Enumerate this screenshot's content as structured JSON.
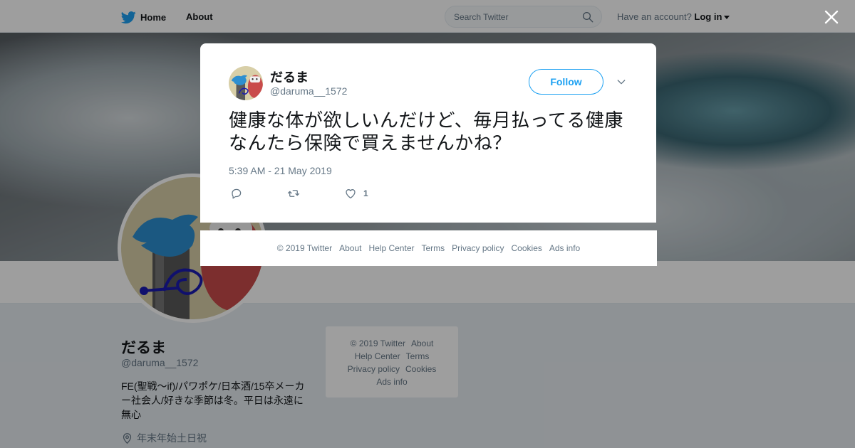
{
  "nav": {
    "home": "Home",
    "about": "About",
    "search_placeholder": "Search Twitter",
    "account_prompt": "Have an account?",
    "login": "Log in"
  },
  "profile": {
    "name": "だるま",
    "handle": "@daruma__1572",
    "bio": "FE(聖戦～if)/パワポケ/日本酒/15卒メーカー社会人/好きな季節は冬。平日は永遠に無心",
    "location": "年末年始土日祝"
  },
  "side_footer": {
    "copyright": "© 2019 Twitter",
    "about": "About",
    "help": "Help Center",
    "terms": "Terms",
    "privacy": "Privacy policy",
    "cookies": "Cookies",
    "ads": "Ads info"
  },
  "tweet": {
    "name": "だるま",
    "handle": "@daruma__1572",
    "follow_label": "Follow",
    "text": "健康な体が欲しいんだけど、毎月払ってる健康なんたら保険で買えませんかね？",
    "timestamp": "5:39 AM - 21 May 2019",
    "like_count": "1"
  },
  "modal_footer": {
    "copyright": "© 2019 Twitter",
    "about": "About",
    "help": "Help Center",
    "terms": "Terms",
    "privacy": "Privacy policy",
    "cookies": "Cookies",
    "ads": "Ads info"
  },
  "colors": {
    "twitter_blue": "#1da1f2",
    "text_primary": "#14171a",
    "text_secondary": "#657786"
  },
  "icons": [
    "twitter-bird-icon",
    "search-icon",
    "caret-down-icon",
    "close-icon",
    "chevron-down-icon",
    "reply-icon",
    "retweet-icon",
    "heart-icon",
    "location-pin-icon"
  ]
}
